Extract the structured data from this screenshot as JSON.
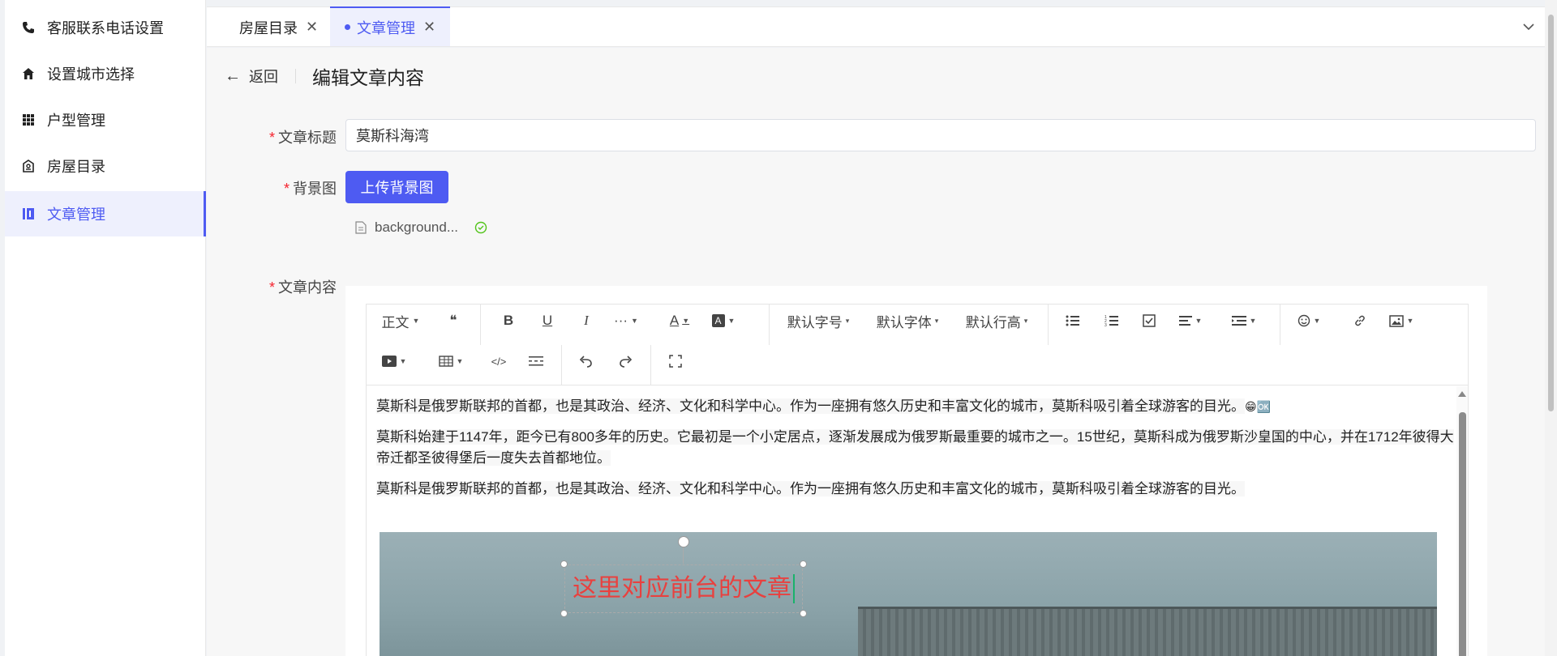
{
  "sidebar": {
    "items": [
      {
        "label": "客服联系电话设置",
        "icon": "phone-icon"
      },
      {
        "label": "设置城市选择",
        "icon": "home-icon"
      },
      {
        "label": "户型管理",
        "icon": "grid-icon"
      },
      {
        "label": "房屋目录",
        "icon": "house-icon"
      },
      {
        "label": "文章管理",
        "icon": "book-icon",
        "active": true
      }
    ]
  },
  "tabs": [
    {
      "label": "房屋目录"
    },
    {
      "label": "文章管理",
      "active": true
    }
  ],
  "header": {
    "back_label": "返回",
    "title": "编辑文章内容"
  },
  "form": {
    "title_label": "文章标题",
    "title_value": "莫斯科海湾",
    "bg_label": "背景图",
    "upload_label": "上传背景图",
    "file_name": "background...",
    "content_label": "文章内容"
  },
  "toolbar": {
    "paragraph": "正文",
    "font_size": "默认字号",
    "font_family": "默认字体",
    "line_height": "默认行高"
  },
  "content": {
    "p1": "莫斯科是俄罗斯联邦的首都，也是其政治、经济、文化和科学中心。作为一座拥有悠久历史和丰富文化的城市，莫斯科吸引着全球游客的目光。",
    "p1_emoji_1": "😁",
    "p1_emoji_2": "🆗",
    "p2": "莫斯科始建于1147年，距今已有800多年的历史。它最初是一个小定居点，逐渐发展成为俄罗斯最重要的城市之一。15世纪，莫斯科成为俄罗斯沙皇国的中心，并在1712年彼得大帝迁都圣彼得堡后一度失去首都地位。",
    "p3": "莫斯科是俄罗斯联邦的首都，也是其政治、经济、文化和科学中心。作为一座拥有悠久历史和丰富文化的城市，莫斯科吸引着全球游客的目光。",
    "overlay_text": "这里对应前台的文章"
  },
  "colors": {
    "accent": "#4e5bf2",
    "required": "#f5222d",
    "overlay_text": "#e8413f",
    "success": "#52c41a"
  }
}
